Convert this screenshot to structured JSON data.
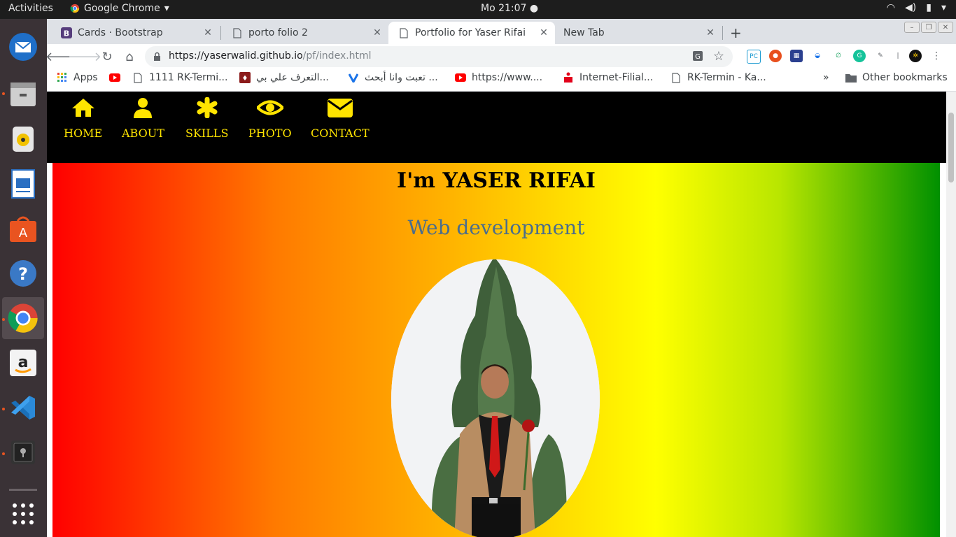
{
  "system": {
    "activities": "Activities",
    "app_menu": "Google Chrome",
    "clock": "Mo 21:07"
  },
  "tabs": [
    {
      "label": "Cards · Bootstrap",
      "favicon": "bootstrap-icon"
    },
    {
      "label": "porto folio 2",
      "favicon": "page-icon"
    },
    {
      "label": "Portfolio for Yaser Rifai",
      "favicon": "page-icon",
      "active": true
    },
    {
      "label": "New Tab",
      "favicon": "none"
    }
  ],
  "address": {
    "host": "https://yaserwalid.github.io",
    "path": "/pf/index.html"
  },
  "bookmarks": {
    "apps": "Apps",
    "items": [
      {
        "label": "",
        "icon": "youtube-icon"
      },
      {
        "label": "1111 RK-Termi...",
        "icon": "page-icon"
      },
      {
        "label": "التعرف علي بي...",
        "icon": "app-icon"
      },
      {
        "label": "تعبت وانا أبحث ...",
        "icon": "v-icon"
      },
      {
        "label": "https://www....",
        "icon": "youtube-icon"
      },
      {
        "label": "Internet-Filial...",
        "icon": "sparkasse-icon"
      },
      {
        "label": "RK-Termin - Ka...",
        "icon": "page-icon"
      }
    ],
    "more": "»",
    "other": "Other bookmarks"
  },
  "site": {
    "nav": [
      {
        "label": "HOME",
        "icon": "home-icon"
      },
      {
        "label": "ABOUT",
        "icon": "user-icon"
      },
      {
        "label": "SKILLS",
        "icon": "asterisk-icon"
      },
      {
        "label": "PHOTO",
        "icon": "eye-icon"
      },
      {
        "label": "CONTACT",
        "icon": "envelope-icon"
      }
    ],
    "title": "I'm YASER RIFAI",
    "subtitle": "Web development"
  },
  "colors": {
    "nav_accent": "#ffe400",
    "subtitle": "#4a6d8c",
    "gradient": [
      "#ff0000",
      "#ff7a00",
      "#ffff00",
      "#009000"
    ]
  }
}
